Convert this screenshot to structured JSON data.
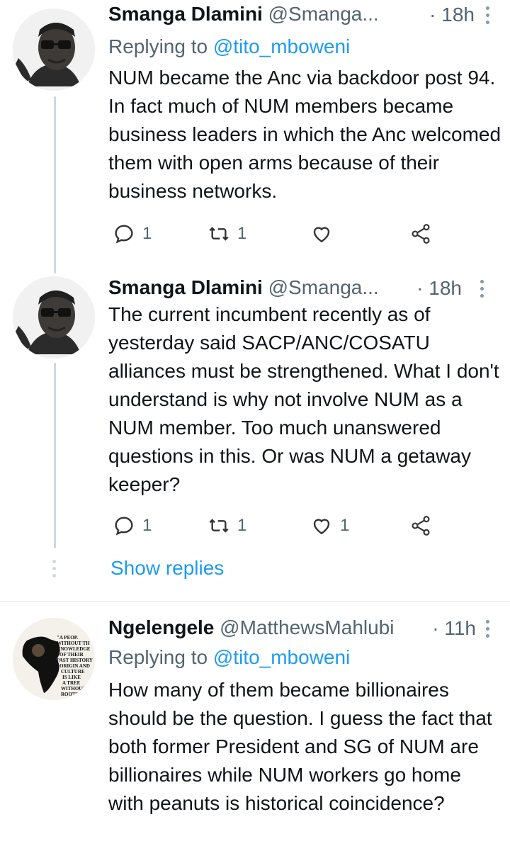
{
  "tweets": [
    {
      "name": "Smanga Dlamini",
      "handle": "@Smanga...",
      "time": "· 18h",
      "replying_label": "Replying to ",
      "replying_to": "@tito_mboweni",
      "text": "NUM became the Anc via backdoor post 94. In fact much of NUM members became business leaders in which the Anc welcomed them with open arms because of their business networks.",
      "replies": "1",
      "retweets": "1",
      "likes": ""
    },
    {
      "name": "Smanga Dlamini",
      "handle": "@Smanga...",
      "time": "· 18h",
      "text": "The current incumbent recently as of yesterday said SACP/ANC/COSATU alliances must be strengthened. What I don't understand is why not involve NUM as a NUM member. Too much unanswered questions in this. Or was NUM a getaway keeper?",
      "replies": "1",
      "retweets": "1",
      "likes": "1"
    },
    {
      "name": "Ngelengele",
      "handle": "@MatthewsMahlubi",
      "time": "· 11h",
      "replying_label": "Replying to ",
      "replying_to": "@tito_mboweni",
      "text": "How many of them became billionaires should be the question. I guess the fact that both former President and SG of NUM are billionaires while NUM workers go home with peanuts is historical coincidence?",
      "avatar_text": "\"A PEOPLE WITHOUT THE KNOWLEDGE OF THEIR PAST HISTORY, ORIGIN AND CULTURE IS LIKE A TREE WITHOUT ROOTS\""
    }
  ],
  "show_replies": "Show replies",
  "colors": {
    "link": "#1d9bf0",
    "secondary": "#536471",
    "thread": "#cfd9de"
  },
  "icons": [
    "reply-icon",
    "retweet-icon",
    "like-icon",
    "share-icon",
    "more-icon"
  ]
}
